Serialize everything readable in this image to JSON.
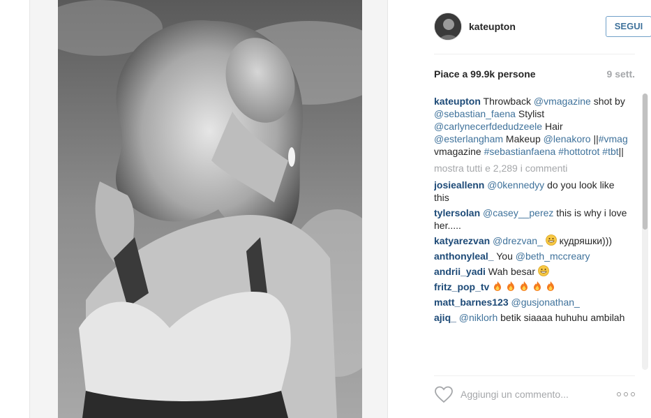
{
  "post": {
    "username": "kateupton",
    "follow_label": "SEGUI",
    "likes": "Piace a 99.9k persone",
    "time": "9 sett.",
    "caption": {
      "user": "kateupton",
      "t1": " Throwback ",
      "m1": "@vmagazine",
      "t2": " shot by ",
      "m2": "@sebastian_faena",
      "t3": " Stylist ",
      "m3": "@carlynecerfdedudzeele",
      "t4": " Hair ",
      "m4": "@esterlangham",
      "t5": " Makeup ",
      "m5": "@lenakoro",
      "t6": " ||",
      "h1": "#vmag",
      "t7": " vmagazine ",
      "h2": "#sebastianfaena",
      "t8": " ",
      "h3": "#hottotrot",
      "t9": " ",
      "h4": "#tbt",
      "t10": "||"
    },
    "load_more": "mostra tutti e 2,289 i commenti",
    "comments": [
      {
        "user": "josieallenn",
        "mention": "@0kennedyy",
        "text": " do you look like this"
      },
      {
        "user": "tylersolan",
        "mention": "@casey__perez",
        "text": " this is why i love her....."
      },
      {
        "user": "katyarezvan",
        "mention": "@drezvan_",
        "text": " кудряшки)))"
      },
      {
        "user": "anthonyleal_",
        "text1": " You ",
        "mention": "@beth_mccreary"
      },
      {
        "user": "andrii_yadi",
        "text": " Wah besar "
      },
      {
        "user": "fritz_pop_tv",
        "text": " "
      },
      {
        "user": "matt_barnes123",
        "mention": "@gusjonathan_"
      },
      {
        "user": "ajiq_",
        "mention": "@niklorh",
        "text": " betik siaaaa huhuhu ambilah"
      }
    ],
    "comment_placeholder": "Aggiungi un commento..."
  },
  "icons": {
    "heart": "heart-outline-icon",
    "more": "more-options-icon",
    "fire": "fire-emoji",
    "smile": "grinning-emoji"
  },
  "colors": {
    "link": "#3f729b",
    "username": "#1d4a77",
    "muted": "#a5a7aa",
    "follow_border": "#70a0c8"
  }
}
